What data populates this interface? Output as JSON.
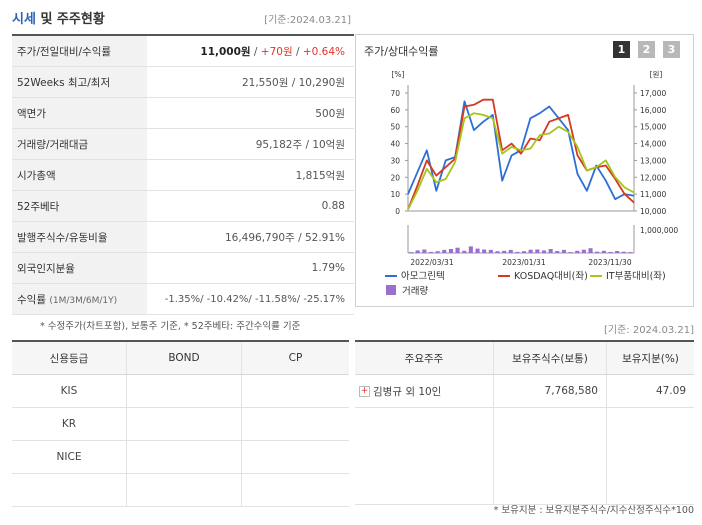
{
  "header": {
    "title_em": "시세",
    "title_rest": " 및 주주현황",
    "date": "[기준:2024.03.21]"
  },
  "quote": {
    "rows": [
      {
        "key": "주가/전일대비/수익률",
        "price": "11,000원",
        "sep1": " / ",
        "change": "+70원",
        "sep2": " / ",
        "pct": "+0.64%"
      },
      {
        "key": "52Weeks 최고/최저",
        "value": "21,550원 / 10,290원"
      },
      {
        "key": "액면가",
        "value": "500원"
      },
      {
        "key": "거래량/거래대금",
        "value": "95,182주 / 10억원"
      },
      {
        "key": "시가총액",
        "value": "1,815억원"
      },
      {
        "key": "52주베타",
        "value": "0.88"
      },
      {
        "key": "발행주식수/유동비율",
        "value": "16,496,790주 / 52.91%"
      },
      {
        "key": "외국인지분율",
        "value": "1.79%"
      },
      {
        "key": "수익률",
        "key_sub": "(1M/3M/6M/1Y)",
        "value": "-1.35%/ -10.42%/ -11.58%/ -25.17%"
      }
    ],
    "footnote": "* 수정주가(차트포함), 보통주 기준, * 52주베타: 주간수익률 기준"
  },
  "chart_panel": {
    "title": "주가/상대수익률",
    "tabs": [
      "1",
      "2",
      "3"
    ]
  },
  "chart_data": {
    "type": "line",
    "y_left_unit": "[%]",
    "y_right_unit": "[원]",
    "y_left_ticks": [
      "70",
      "60",
      "50",
      "40",
      "30",
      "20",
      "10",
      "0"
    ],
    "y_right_ticks": [
      "17,000",
      "16,000",
      "15,000",
      "14,000",
      "13,000",
      "12,000",
      "11,000",
      "10,000"
    ],
    "ylim_left": [
      0,
      70
    ],
    "volume_tick": "1,000,000",
    "x_labels": [
      "2022/03/31",
      "2023/01/31",
      "2023/11/30"
    ],
    "series": [
      {
        "name": "아모그린텍",
        "color": "#2d6fd6",
        "values": [
          10,
          23,
          36,
          12,
          30,
          32,
          65,
          48,
          53,
          57,
          18,
          33,
          36,
          55,
          58,
          62,
          55,
          48,
          22,
          12,
          27,
          18,
          7,
          10,
          9
        ]
      },
      {
        "name": "KOSDAQ대비(좌)",
        "color": "#d33a1f",
        "values": [
          1,
          15,
          30,
          21,
          26,
          31,
          62,
          63,
          66,
          66,
          36,
          40,
          34,
          43,
          42,
          53,
          55,
          57,
          33,
          24,
          26,
          27,
          19,
          10,
          5
        ]
      },
      {
        "name": "IT부품대비(좌)",
        "color": "#a5c51a",
        "values": [
          1,
          12,
          25,
          17,
          19,
          29,
          55,
          58,
          57,
          55,
          34,
          38,
          36,
          37,
          45,
          46,
          50,
          47,
          38,
          24,
          26,
          30,
          20,
          14,
          11
        ]
      }
    ],
    "volume": {
      "name": "거래량",
      "color": "#9a70cc",
      "values": [
        0.04,
        0.12,
        0.16,
        0.05,
        0.08,
        0.14,
        0.18,
        0.24,
        0.1,
        0.3,
        0.2,
        0.16,
        0.14,
        0.08,
        0.1,
        0.14,
        0.05,
        0.08,
        0.15,
        0.16,
        0.12,
        0.18,
        0.09,
        0.14,
        0.04,
        0.1,
        0.15,
        0.22,
        0.06,
        0.1,
        0.05,
        0.09,
        0.06,
        0.04
      ]
    },
    "legend": [
      "아모그린텍",
      "KOSDAQ대비(좌)",
      "IT부품대비(좌)",
      "거래량"
    ]
  },
  "date_right": "[기준: 2024.03.21]",
  "credit": {
    "headers": [
      "신용등급",
      "BOND",
      "CP"
    ],
    "rows": [
      [
        "KIS",
        "",
        ""
      ],
      [
        "KR",
        "",
        ""
      ],
      [
        "NICE",
        "",
        ""
      ],
      [
        "",
        "",
        ""
      ]
    ]
  },
  "holders": {
    "headers": [
      "주요주주",
      "보유주식수(보통)",
      "보유지분(%)"
    ],
    "rows": [
      {
        "name": "김병규 외 10인",
        "shares": "7,768,580",
        "ratio": "47.09"
      }
    ],
    "footnote": "* 보유지분 : 보유지분주식수/지수산정주식수*100"
  }
}
